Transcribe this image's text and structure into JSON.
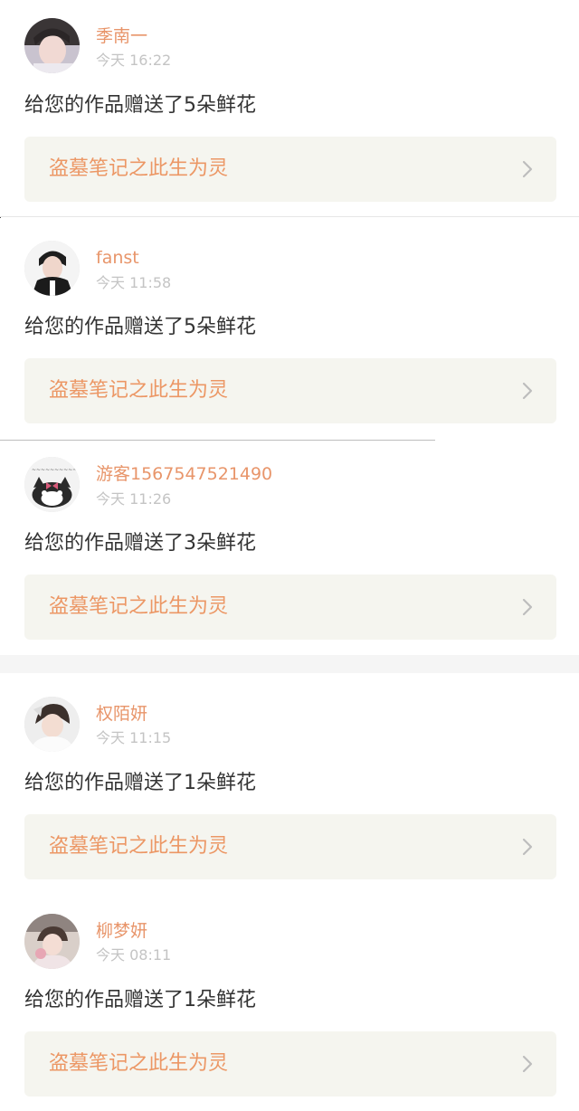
{
  "notifications": [
    {
      "username": "季南一",
      "time": "今天 16:22",
      "message": "给您的作品赠送了5朵鲜花",
      "work_title": "盗墓笔记之此生为灵"
    },
    {
      "username": "fanst",
      "time": "今天 11:58",
      "message": "给您的作品赠送了5朵鲜花",
      "work_title": "盗墓笔记之此生为灵"
    },
    {
      "username": "游客1567547521490",
      "time": "今天 11:26",
      "message": "给您的作品赠送了3朵鲜花",
      "work_title": "盗墓笔记之此生为灵"
    },
    {
      "username": "权陌妍",
      "time": "今天 11:15",
      "message": "给您的作品赠送了1朵鲜花",
      "work_title": "盗墓笔记之此生为灵"
    },
    {
      "username": "柳梦妍",
      "time": "今天 08:11",
      "message": "给您的作品赠送了1朵鲜花",
      "work_title": "盗墓笔记之此生为灵"
    }
  ],
  "icons": {
    "chevron": "chevron-right-icon"
  },
  "colors": {
    "username": "#e8956a",
    "work_title": "#ec9765",
    "time": "#c4c4c4",
    "message": "#333333",
    "work_card_bg": "#f5f5ef"
  }
}
